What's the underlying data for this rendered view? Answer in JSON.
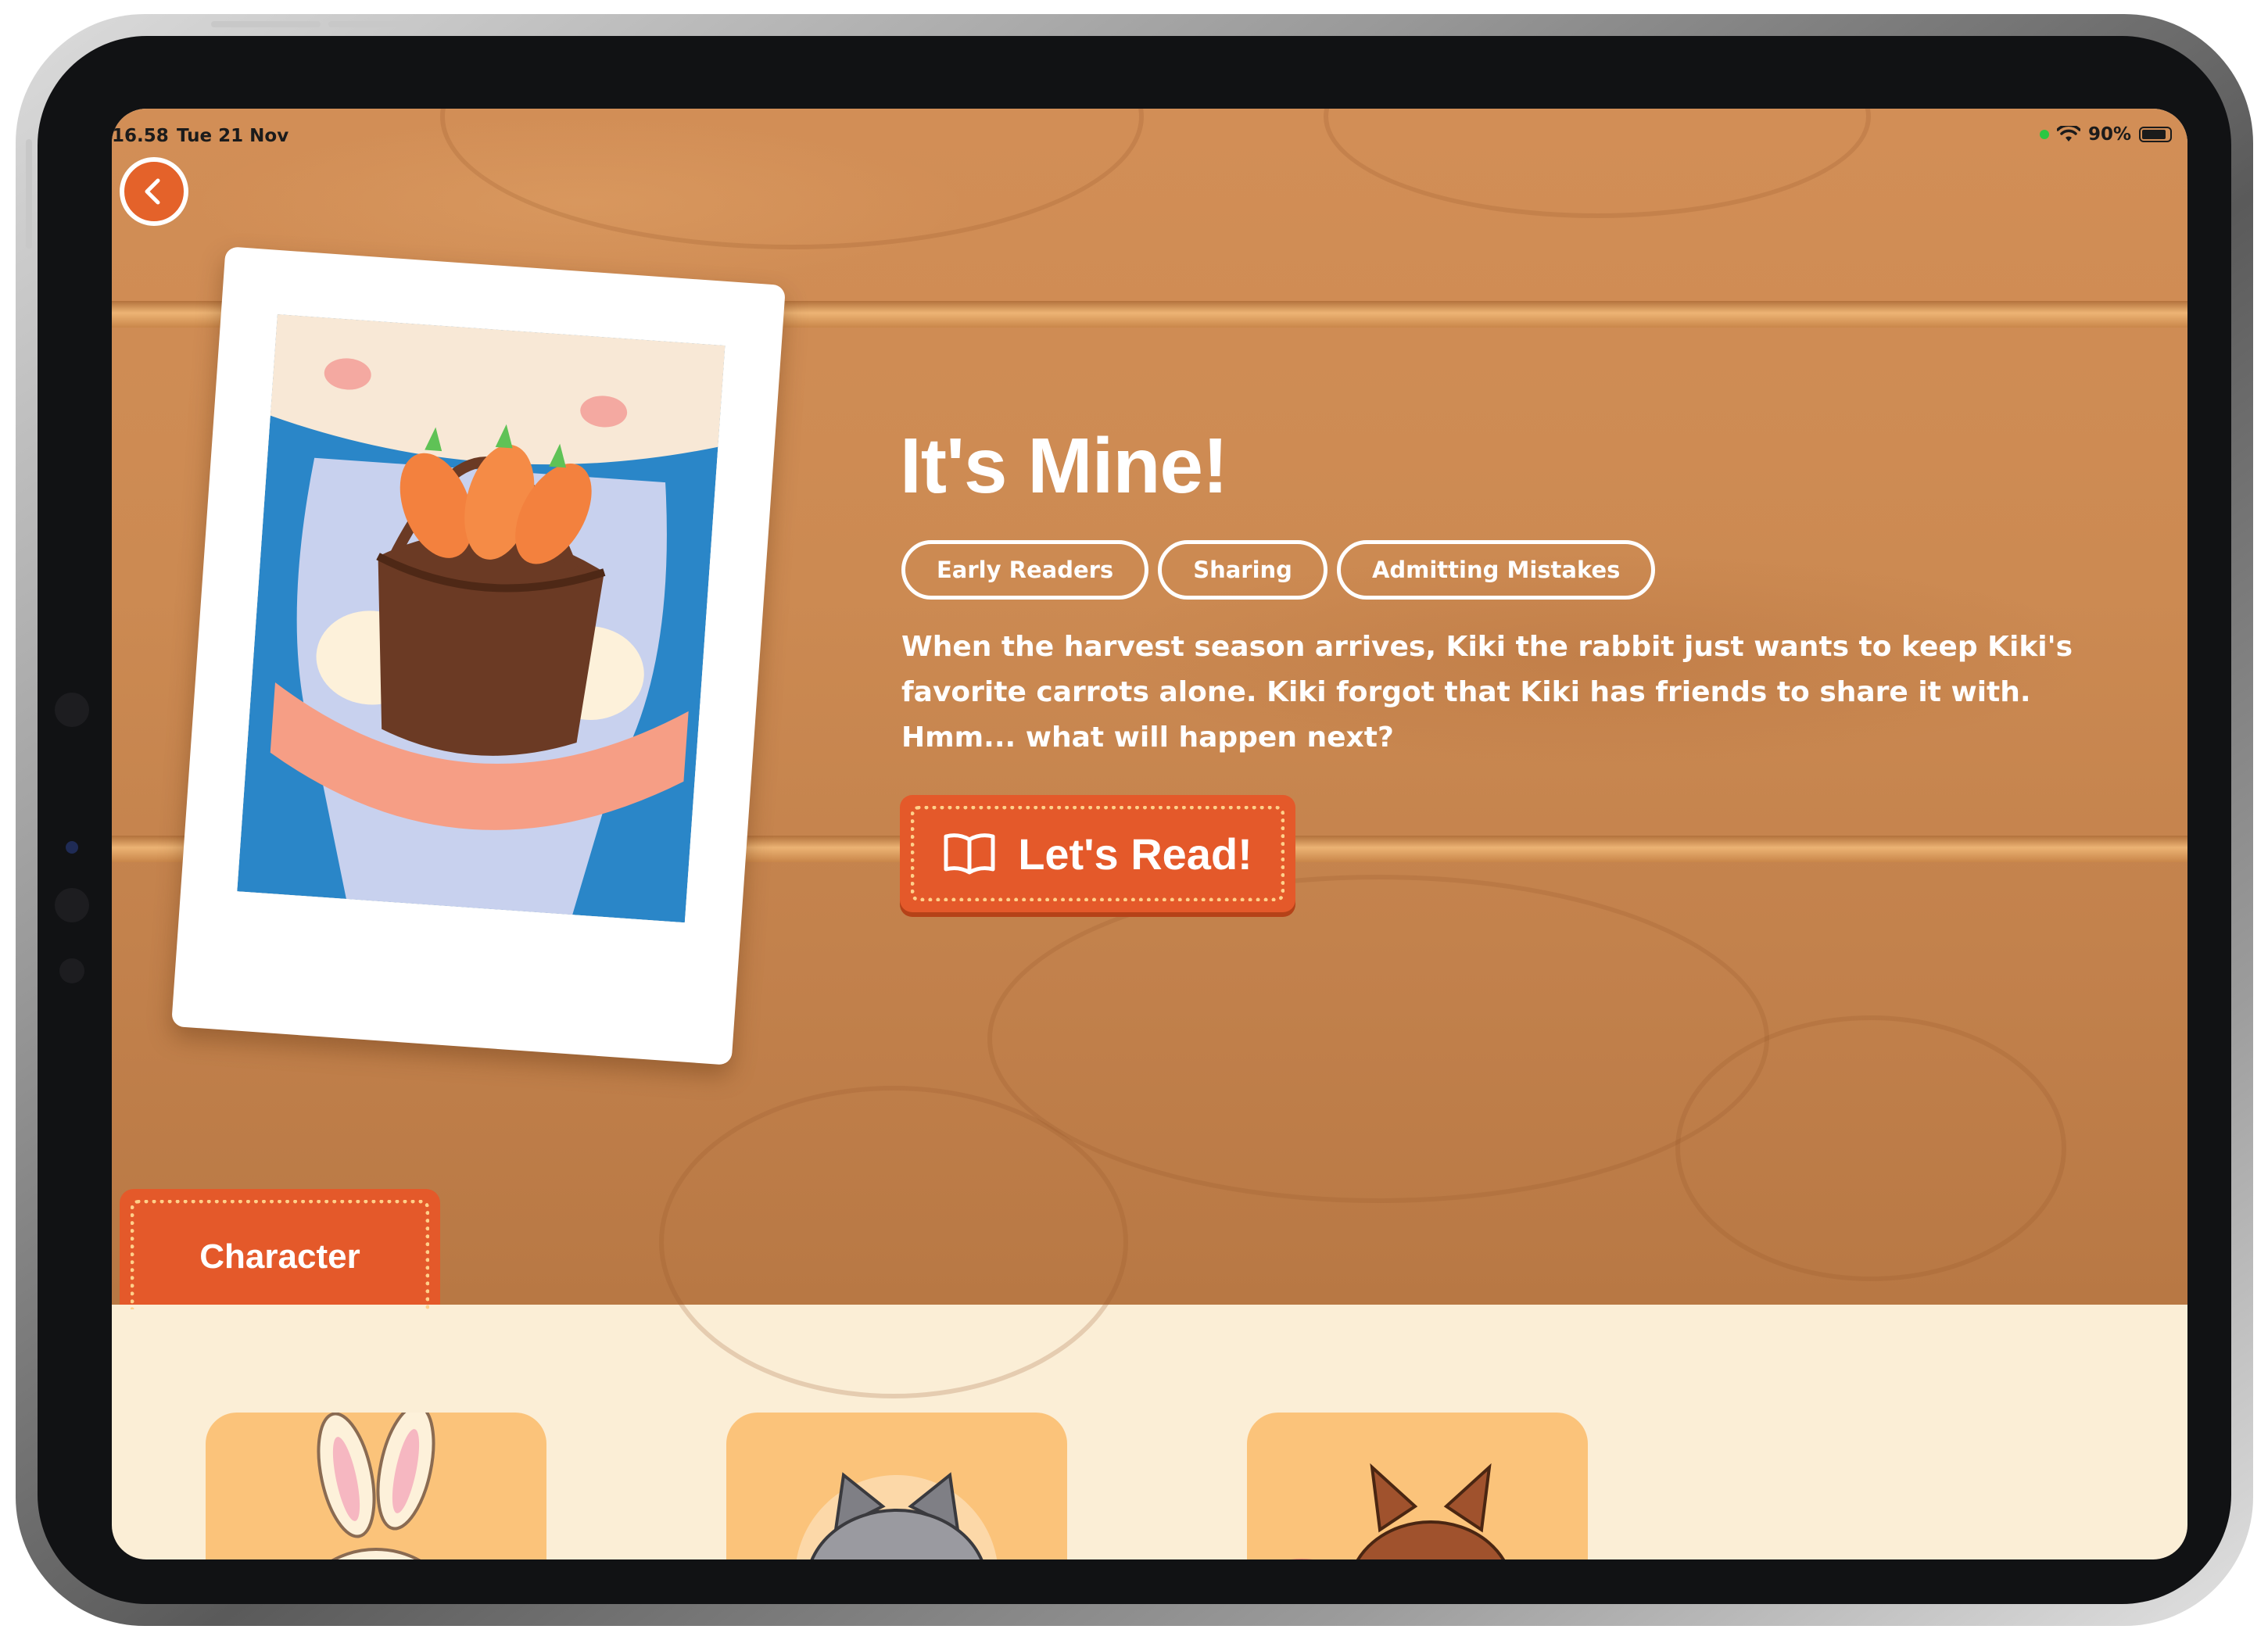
{
  "status_bar": {
    "time": "16.58",
    "date": "Tue 21 Nov",
    "battery": "90%"
  },
  "back_button": {
    "icon": "chevron-left-icon"
  },
  "book": {
    "title": "It's Mine!",
    "tags": [
      "Early Readers",
      "Sharing",
      "Admitting Mistakes"
    ],
    "description": "When the harvest season arrives, Kiki the rabbit just wants to keep Kiki's favorite carrots alone. Kiki forgot that Kiki has friends to share it with. Hmm... what will happen next?",
    "read_button": {
      "label": "Let's Read!",
      "icon": "book-open-icon"
    }
  },
  "section_tab": {
    "label": "Character"
  },
  "characters": [
    {
      "icon": "rabbit-icon"
    },
    {
      "icon": "raccoon-icon"
    },
    {
      "icon": "squirrel-icon"
    }
  ],
  "colors": {
    "accent": "#e4592a",
    "wood": "#cc8a52",
    "cream": "#fbeed6",
    "card": "#fbc37a"
  }
}
